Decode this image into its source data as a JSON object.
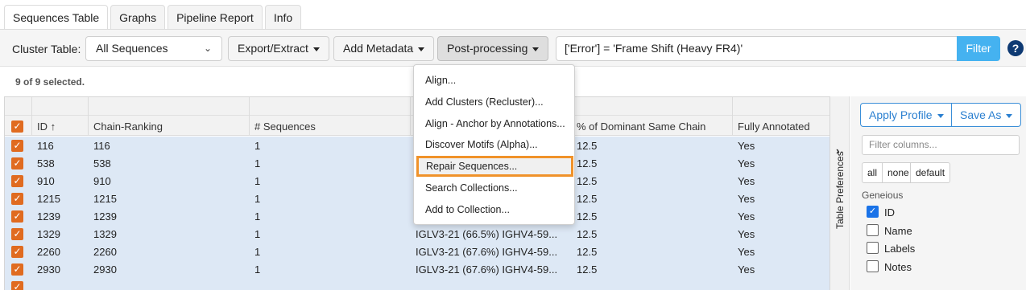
{
  "tabs": [
    "Sequences Table",
    "Graphs",
    "Pipeline Report",
    "Info"
  ],
  "toolbar": {
    "cluster_label": "Cluster Table:",
    "cluster_value": "All Sequences",
    "export": "Export/Extract",
    "add_metadata": "Add Metadata",
    "post_processing": "Post-processing",
    "filter_value": "['Error'] = 'Frame Shift (Heavy FR4)'",
    "filter_button": "Filter",
    "help": "?"
  },
  "selection": "9 of 9 selected.",
  "columns": [
    "ID",
    "Chain-Ranking",
    "# Sequences",
    "% of Dominant Same Chain",
    "Fully Annotated"
  ],
  "sort_icon": "↑",
  "rows": [
    {
      "id": "116",
      "rank": "116",
      "seqs": "1",
      "chain": "",
      "pct": "12.5",
      "fa": "Yes"
    },
    {
      "id": "538",
      "rank": "538",
      "seqs": "1",
      "chain": "",
      "pct": "12.5",
      "fa": "Yes"
    },
    {
      "id": "910",
      "rank": "910",
      "seqs": "1",
      "chain": "",
      "pct": "12.5",
      "fa": "Yes"
    },
    {
      "id": "1215",
      "rank": "1215",
      "seqs": "1",
      "chain": "",
      "pct": "12.5",
      "fa": "Yes"
    },
    {
      "id": "1239",
      "rank": "1239",
      "seqs": "1",
      "chain": "",
      "pct": "12.5",
      "fa": "Yes"
    },
    {
      "id": "1329",
      "rank": "1329",
      "seqs": "1",
      "chain": "IGLV3-21 (66.5%) IGHV4-59...",
      "pct": "12.5",
      "fa": "Yes"
    },
    {
      "id": "2260",
      "rank": "2260",
      "seqs": "1",
      "chain": "IGLV3-21 (67.6%) IGHV4-59...",
      "pct": "12.5",
      "fa": "Yes"
    },
    {
      "id": "2930",
      "rank": "2930",
      "seqs": "1",
      "chain": "IGLV3-21 (67.6%) IGHV4-59...",
      "pct": "12.5",
      "fa": "Yes"
    }
  ],
  "menu": [
    "Align...",
    "Add Clusters (Recluster)...",
    "Align - Anchor by Annotations...",
    "Discover Motifs (Alpha)...",
    "Repair Sequences...",
    "Search Collections...",
    "Add to Collection..."
  ],
  "prefs_tab": "Table Preferences",
  "panel": {
    "apply_profile": "Apply Profile",
    "save_as": "Save As",
    "filter_placeholder": "Filter columns...",
    "seg_all": "all",
    "seg_none": "none",
    "seg_default": "default",
    "group": "Geneious",
    "columns": [
      {
        "label": "ID",
        "checked": true
      },
      {
        "label": "Name",
        "checked": false
      },
      {
        "label": "Labels",
        "checked": false
      },
      {
        "label": "Notes",
        "checked": false
      }
    ]
  }
}
